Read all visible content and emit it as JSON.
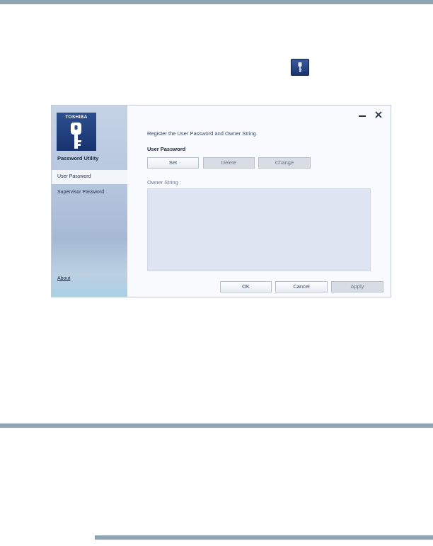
{
  "window": {
    "sidebar": {
      "logo_text": "TOSHIBA",
      "title": "Password Utility",
      "items": [
        {
          "label": "User Password",
          "active": true
        },
        {
          "label": "Supervisor Password",
          "active": false
        }
      ],
      "about_label": "About"
    },
    "main": {
      "instruction": "Register the User Password and Owner String.",
      "user_password_label": "User Password",
      "password_buttons": {
        "set": "Set",
        "delete": "Delete",
        "change": "Change"
      },
      "owner_string_label": "Owner String :",
      "owner_string_value": "",
      "footer_buttons": {
        "ok": "OK",
        "cancel": "Cancel",
        "apply": "Apply"
      }
    }
  },
  "colors": {
    "rule": "#8fa4b3",
    "logo_bg": "#173270",
    "sidebar_bg": "#b3c4dc",
    "owner_area_bg": "#dfe4f2",
    "disabled_button": "#d8dde5"
  },
  "icons": [
    "password-utility-key-icon",
    "minimize-icon",
    "close-icon",
    "key-icon"
  ]
}
